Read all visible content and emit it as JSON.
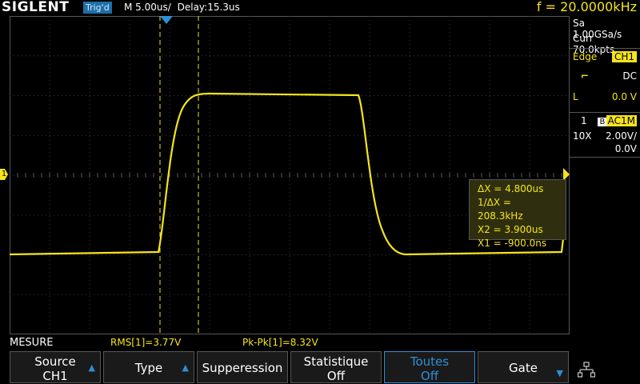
{
  "header": {
    "brand": "SIGLENT",
    "trigger_status": "Trig'd",
    "timebase": "M 5.00us/",
    "delay": "Delay:15.3us",
    "frequency": "f = 20.0000kHz"
  },
  "acquisition": {
    "sample_rate": "Sa 1.00GSa/s",
    "memory_depth": "Curr 70.0kpts"
  },
  "trigger": {
    "type_label": "Edge",
    "source": "CH1",
    "coupling": "DC",
    "level_label": "L",
    "level_value": "0.0 V"
  },
  "channel1": {
    "number": "1",
    "bw_badge": "B",
    "coupling": "AC1M",
    "probe": "10X",
    "volts_per_div": "2.00V/",
    "offset": "0.0V",
    "marker": "1"
  },
  "cursors": {
    "delta_x": "ΔX = 4.800us",
    "inv_delta_x": "1/ΔX = 208.3kHz",
    "x2": "X2 = 3.900us",
    "x1": "X1 = -900.0ns"
  },
  "measurements": {
    "menu_label": "MESURE",
    "rms": "RMS[1]=3.77V",
    "pkpk": "Pk-Pk[1]=8.32V"
  },
  "softkeys": [
    {
      "line1": "Source",
      "line2": "CH1",
      "arrow": "up"
    },
    {
      "line1": "Type",
      "line2": "",
      "arrow": "up"
    },
    {
      "line1": "Supperession",
      "line2": "",
      "arrow": ""
    },
    {
      "line1": "Statistique",
      "line2": "Off",
      "arrow": ""
    },
    {
      "line1": "Toutes",
      "line2": "Off",
      "arrow": ""
    },
    {
      "line1": "Gate",
      "line2": "",
      "arrow": "down"
    }
  ],
  "icons": {
    "network": "network-icon",
    "trigger_edge": "rising-edge-icon"
  },
  "colors": {
    "trace": "#f5e51a",
    "accent": "#2e8fd8",
    "trig_badge": "#1e6fa6",
    "grid": "#3a3a3a"
  }
}
